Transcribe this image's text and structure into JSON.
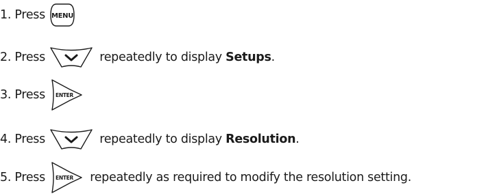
{
  "steps": [
    {
      "number": "1.",
      "press_label": "Press",
      "key": {
        "icon": "menu-key-icon",
        "label": "MENU"
      }
    },
    {
      "number": "2.",
      "press_label": "Press",
      "key": {
        "icon": "down-arrow-key-icon"
      },
      "before_bold": " repeatedly to display ",
      "bold": "Setups",
      "after_bold": "."
    },
    {
      "number": "3.",
      "press_label": "Press",
      "key": {
        "icon": "enter-key-icon",
        "label": "ENTER"
      }
    },
    {
      "number": "4.",
      "press_label": "Press",
      "key": {
        "icon": "down-arrow-key-icon"
      },
      "before_bold": " repeatedly to display ",
      "bold": "Resolution",
      "after_bold": "."
    },
    {
      "number": "5.",
      "press_label": "Press",
      "key": {
        "icon": "enter-key-icon",
        "label": "ENTER"
      },
      "trailing_text": " repeatedly as required to modify the resolution setting."
    }
  ]
}
